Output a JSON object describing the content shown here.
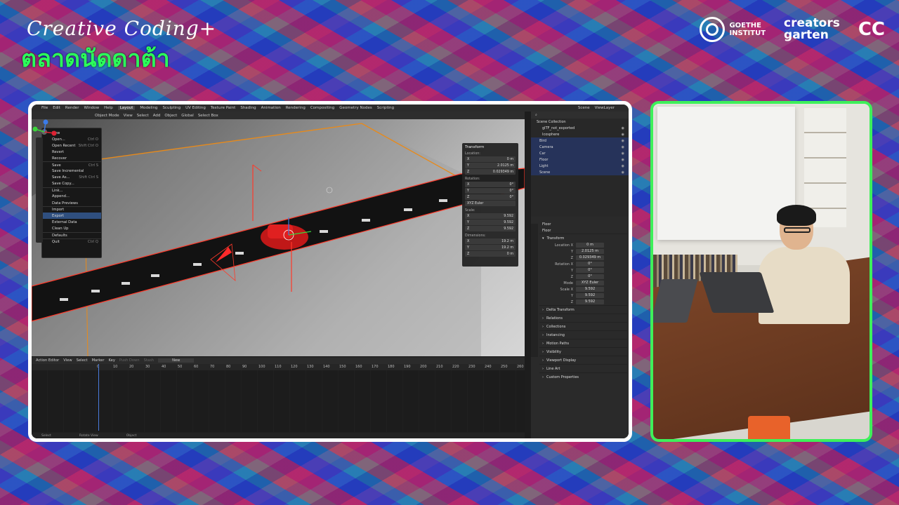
{
  "overlay": {
    "title_script": "Creative Coding+",
    "title_thai": "ตลาดนัดดาต้า",
    "logos": {
      "goethe": "GOETHE\nINSTITUT",
      "creators": "creators\ngarten",
      "cc": "CC"
    }
  },
  "blender": {
    "workspace_tabs": [
      "File",
      "Edit",
      "Render",
      "Window",
      "Help",
      "Layout",
      "Modeling",
      "Sculpting",
      "UV Editing",
      "Texture Paint",
      "Shading",
      "Animation",
      "Rendering",
      "Compositing",
      "Geometry Nodes",
      "Scripting"
    ],
    "active_tab": "Layout",
    "scene": "Scene",
    "view_layer": "ViewLayer",
    "viewport_header": [
      "Object Mode",
      "View",
      "Select",
      "Add",
      "Object",
      "Global",
      "Select Box"
    ],
    "file_menu": [
      {
        "label": "New",
        "shortcut": ""
      },
      {
        "label": "Open...",
        "shortcut": "Ctrl O"
      },
      {
        "label": "Open Recent",
        "shortcut": "Shift Ctrl O"
      },
      {
        "label": "Revert",
        "shortcut": ""
      },
      {
        "label": "Recover",
        "shortcut": ""
      },
      {
        "label": "Save",
        "shortcut": "Ctrl S"
      },
      {
        "label": "Save Incremental",
        "shortcut": ""
      },
      {
        "label": "Save As...",
        "shortcut": "Shift Ctrl S"
      },
      {
        "label": "Save Copy...",
        "shortcut": ""
      },
      {
        "label": "Link...",
        "shortcut": ""
      },
      {
        "label": "Append...",
        "shortcut": ""
      },
      {
        "label": "Data Previews",
        "shortcut": ""
      },
      {
        "label": "Import",
        "shortcut": ""
      },
      {
        "label": "Export",
        "shortcut": ""
      },
      {
        "label": "External Data",
        "shortcut": ""
      },
      {
        "label": "Clean Up",
        "shortcut": ""
      },
      {
        "label": "Defaults",
        "shortcut": ""
      },
      {
        "label": "Quit",
        "shortcut": "Ctrl Q"
      }
    ],
    "npanel": {
      "title": "Transform",
      "location_label": "Location:",
      "location": [
        "0 m",
        "2.0125 m",
        "0.029349 m"
      ],
      "rotation_label": "Rotation:",
      "rotation": [
        "0°",
        "0°",
        "0°"
      ],
      "rotation_mode": "XYZ Euler",
      "scale_label": "Scale:",
      "scale": [
        "9.592",
        "9.592",
        "9.592"
      ],
      "dimensions_label": "Dimensions:",
      "dimensions": [
        "19.2 m",
        "19.2 m",
        "0 m"
      ],
      "axes": [
        "X",
        "Y",
        "Z"
      ]
    },
    "timeline": {
      "editor": "Action Editor",
      "menus": [
        "View",
        "Select",
        "Marker",
        "Key"
      ],
      "buttons": [
        "Push Down",
        "Stash",
        "New"
      ],
      "frames": [
        "0",
        "10",
        "20",
        "30",
        "40",
        "50",
        "60",
        "70",
        "80",
        "90",
        "100",
        "110",
        "120",
        "130",
        "140",
        "150",
        "160",
        "170",
        "180",
        "190",
        "200",
        "210",
        "220",
        "230",
        "240",
        "250",
        "260"
      ],
      "current": "0"
    },
    "statusbar": [
      "Select",
      "Rotate View",
      "Object"
    ],
    "outliner": {
      "title": "Scene Collection",
      "items": [
        {
          "label": "glTF_not_exported",
          "selected": false
        },
        {
          "label": "Icosphere",
          "selected": false
        },
        {
          "label": "Bird",
          "selected": true
        },
        {
          "label": "Camera",
          "selected": true
        },
        {
          "label": "Car",
          "selected": true
        },
        {
          "label": "Floor",
          "selected": true
        },
        {
          "label": "Light",
          "selected": true
        },
        {
          "label": "Scene",
          "selected": true
        }
      ]
    },
    "properties": {
      "object": "Floor",
      "mesh": "Floor",
      "section": "Transform",
      "location_label": "Location X",
      "location": [
        "0 m",
        "2.0125 m",
        "0.029349 m"
      ],
      "rotation_label": "Rotation X",
      "rotation": [
        "0°",
        "0°",
        "0°"
      ],
      "mode_label": "Mode",
      "mode": "XYZ Euler",
      "scale_label": "Scale X",
      "scale": [
        "9.592",
        "9.592",
        "9.592"
      ],
      "axes": [
        "X",
        "Y",
        "Z"
      ],
      "panels": [
        "Delta Transform",
        "Relations",
        "Collections",
        "Instancing",
        "Motion Paths",
        "Visibility",
        "Viewport Display",
        "Line Art",
        "Custom Properties"
      ]
    }
  },
  "colors": {
    "accent_green": "#3ef05a",
    "blender_select": "#2f4f7f",
    "road_outline": "#ff3a2a"
  }
}
